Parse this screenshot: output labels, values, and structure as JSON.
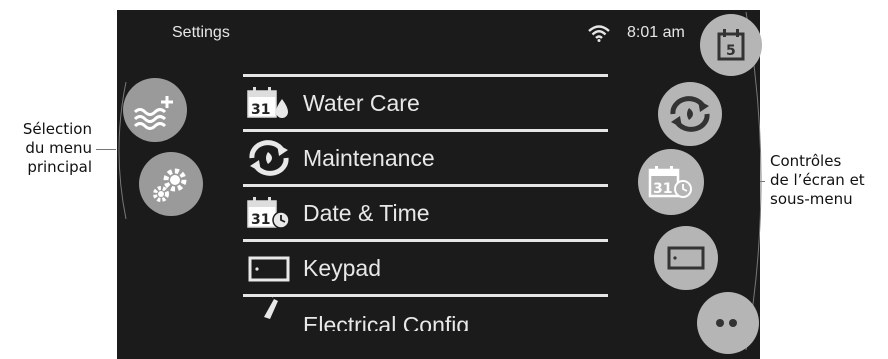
{
  "annotations": {
    "left_line1": "Sélection",
    "left_line2": "du menu",
    "left_line3": "principal",
    "right_line1": "Contrôles",
    "right_line2": "de l’écran et",
    "right_line3": "sous-menu"
  },
  "status_bar": {
    "title": "Settings",
    "time": "8:01 am",
    "wifi_icon": "wifi-icon"
  },
  "menu": {
    "items": [
      {
        "label": "Water Care",
        "icon": "calendar-water-drop-icon"
      },
      {
        "label": "Maintenance",
        "icon": "maintenance-cycle-icon"
      },
      {
        "label": "Date & Time",
        "icon": "calendar-clock-icon"
      },
      {
        "label": "Keypad",
        "icon": "keypad-icon"
      },
      {
        "label": "Electrical Config",
        "icon": "electrical-plug-icon"
      }
    ]
  },
  "main_menu_buttons": [
    {
      "icon": "water-plus-icon"
    },
    {
      "icon": "gears-icon"
    }
  ],
  "screen_controls": [
    {
      "icon": "calendar-5-icon"
    },
    {
      "icon": "maintenance-cycle-icon"
    },
    {
      "icon": "calendar-clock-icon"
    },
    {
      "icon": "keypad-icon"
    },
    {
      "icon": "more-icon"
    }
  ],
  "colors": {
    "screen_bg": "#1b1b1b",
    "text": "#e8e8e8",
    "main_button": "#9a9a9a",
    "control_button": "#b5b5b5"
  }
}
